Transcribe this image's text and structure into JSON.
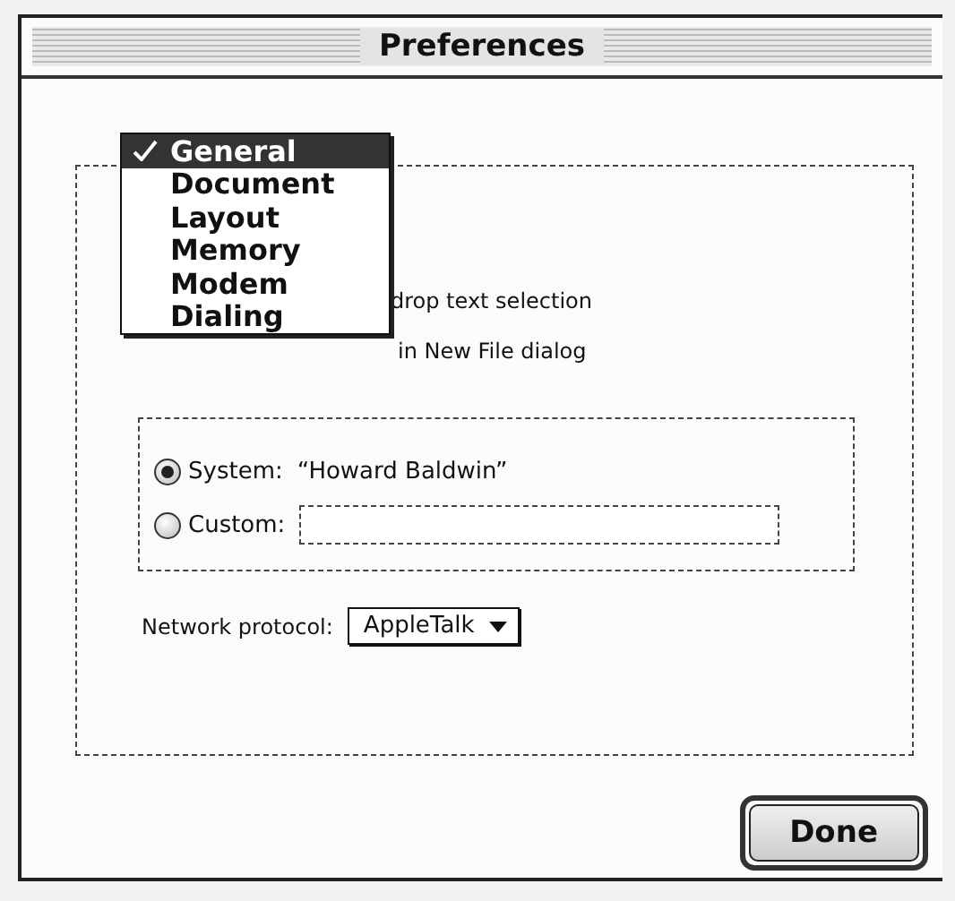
{
  "window": {
    "title": "Preferences"
  },
  "menu": {
    "items": [
      {
        "label": "General",
        "selected": true
      },
      {
        "label": "Document",
        "selected": false
      },
      {
        "label": "Layout",
        "selected": false
      },
      {
        "label": "Memory",
        "selected": false
      },
      {
        "label": "Modem",
        "selected": false
      },
      {
        "label": "Dialing",
        "selected": false
      }
    ]
  },
  "options": [
    {
      "label": "drop text selection"
    },
    {
      "label": "in New File dialog"
    }
  ],
  "user_name": {
    "options": [
      {
        "kind": "text",
        "label": "System:",
        "value": "“Howard Baldwin”",
        "selected": true
      },
      {
        "kind": "field",
        "label": "Custom:",
        "selected": false
      }
    ]
  },
  "network_protocol": {
    "label": "Network protocol:",
    "value": "AppleTalk"
  },
  "buttons": [
    {
      "label": "Done",
      "default": true
    }
  ]
}
